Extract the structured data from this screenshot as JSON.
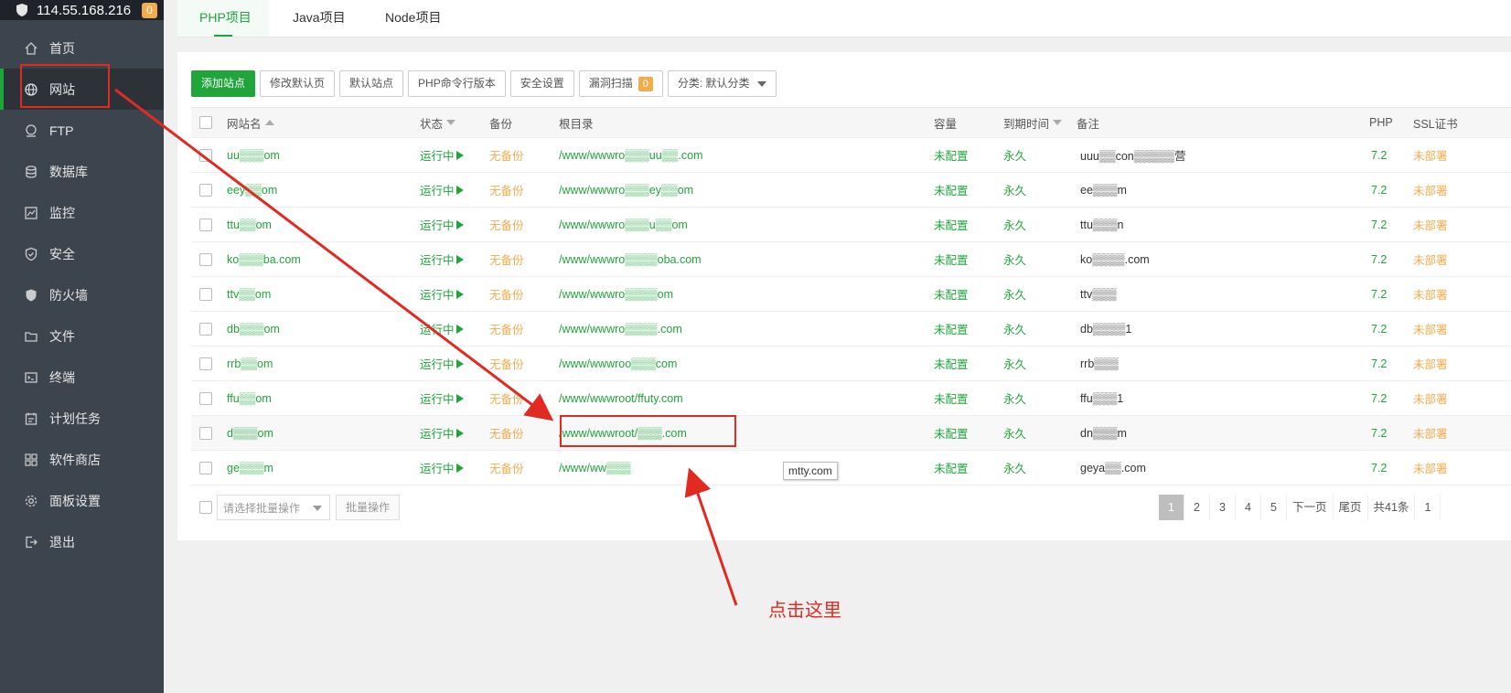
{
  "server": {
    "ip": "114.55.168.216",
    "alert_count": "0"
  },
  "sidebar": {
    "items": [
      {
        "label": "首页",
        "icon": "home-icon"
      },
      {
        "label": "网站",
        "icon": "globe-icon"
      },
      {
        "label": "FTP",
        "icon": "ftp-icon"
      },
      {
        "label": "数据库",
        "icon": "database-icon"
      },
      {
        "label": "监控",
        "icon": "monitor-icon"
      },
      {
        "label": "安全",
        "icon": "security-shield-icon"
      },
      {
        "label": "防火墙",
        "icon": "firewall-icon"
      },
      {
        "label": "文件",
        "icon": "folder-icon"
      },
      {
        "label": "终端",
        "icon": "terminal-icon"
      },
      {
        "label": "计划任务",
        "icon": "calendar-icon"
      },
      {
        "label": "软件商店",
        "icon": "grid-icon"
      },
      {
        "label": "面板设置",
        "icon": "gear-icon"
      },
      {
        "label": "退出",
        "icon": "logout-icon"
      }
    ]
  },
  "tabs": [
    "PHP项目",
    "Java项目",
    "Node项目"
  ],
  "toolbar": {
    "add_site": "添加站点",
    "edit_default": "修改默认页",
    "default_site": "默认站点",
    "php_cli": "PHP命令行版本",
    "security": "安全设置",
    "vuln_scan": "漏洞扫描",
    "vuln_count": "0",
    "category": "分类: 默认分类"
  },
  "table": {
    "headers": {
      "name": "网站名",
      "status": "状态",
      "backup": "备份",
      "root": "根目录",
      "quota": "容量",
      "expire": "到期时间",
      "remark": "备注",
      "php": "PHP",
      "ssl": "SSL证书"
    },
    "rows": [
      {
        "name": "uu▒▒▒om",
        "status": "运行中",
        "backup": "无备份",
        "root": "/www/wwwro▒▒▒uu▒▒.com",
        "quota": "未配置",
        "expire": "永久",
        "remark": "uuu▒▒con▒▒▒▒▒营",
        "php": "7.2",
        "ssl": "未部署"
      },
      {
        "name": "eey▒▒om",
        "status": "运行中",
        "backup": "无备份",
        "root": "/www/wwwro▒▒▒ey▒▒om",
        "quota": "未配置",
        "expire": "永久",
        "remark": "ee▒▒▒m",
        "php": "7.2",
        "ssl": "未部署"
      },
      {
        "name": "ttu▒▒om",
        "status": "运行中",
        "backup": "无备份",
        "root": "/www/wwwro▒▒▒u▒▒om",
        "quota": "未配置",
        "expire": "永久",
        "remark": "ttu▒▒▒n",
        "php": "7.2",
        "ssl": "未部署"
      },
      {
        "name": "ko▒▒▒ba.com",
        "status": "运行中",
        "backup": "无备份",
        "root": "/www/wwwro▒▒▒▒oba.com",
        "quota": "未配置",
        "expire": "永久",
        "remark": "ko▒▒▒▒.com",
        "php": "7.2",
        "ssl": "未部署"
      },
      {
        "name": "ttv▒▒om",
        "status": "运行中",
        "backup": "无备份",
        "root": "/www/wwwro▒▒▒▒om",
        "quota": "未配置",
        "expire": "永久",
        "remark": "ttv▒▒▒",
        "php": "7.2",
        "ssl": "未部署"
      },
      {
        "name": "db▒▒▒om",
        "status": "运行中",
        "backup": "无备份",
        "root": "/www/wwwro▒▒▒▒.com",
        "quota": "未配置",
        "expire": "永久",
        "remark": "db▒▒▒▒1",
        "php": "7.2",
        "ssl": "未部署"
      },
      {
        "name": "rrb▒▒om",
        "status": "运行中",
        "backup": "无备份",
        "root": "/www/wwwroo▒▒▒com",
        "quota": "未配置",
        "expire": "永久",
        "remark": "rrb▒▒▒",
        "php": "7.2",
        "ssl": "未部署"
      },
      {
        "name": "ffu▒▒om",
        "status": "运行中",
        "backup": "无备份",
        "root": "/www/wwwroot/ffuty.com",
        "quota": "未配置",
        "expire": "永久",
        "remark": "ffu▒▒▒1",
        "php": "7.2",
        "ssl": "未部署"
      },
      {
        "name": "d▒▒▒om",
        "status": "运行中",
        "backup": "无备份",
        "root": "/www/wwwroot/▒▒▒.com",
        "quota": "未配置",
        "expire": "永久",
        "remark": "dn▒▒▒m",
        "php": "7.2",
        "ssl": "未部署"
      },
      {
        "name": "ge▒▒▒m",
        "status": "运行中",
        "backup": "无备份",
        "root": "/www/ww▒▒▒",
        "quota": "未配置",
        "expire": "永久",
        "remark": "geya▒▒.com",
        "php": "7.2",
        "ssl": "未部署"
      }
    ],
    "tooltip": "mtty.com"
  },
  "footer": {
    "batch_placeholder": "请选择批量操作",
    "batch_button": "批量操作",
    "pages": [
      "1",
      "2",
      "3",
      "4",
      "5"
    ],
    "next": "下一页",
    "last": "尾页",
    "total": "共41条",
    "trailing": "1"
  },
  "annotation": {
    "note": "点击这里",
    "color": "#e12b22"
  },
  "colors": {
    "accent": "#20a53a",
    "warning": "#f0ad4e",
    "sidebar": "#3c444d"
  }
}
